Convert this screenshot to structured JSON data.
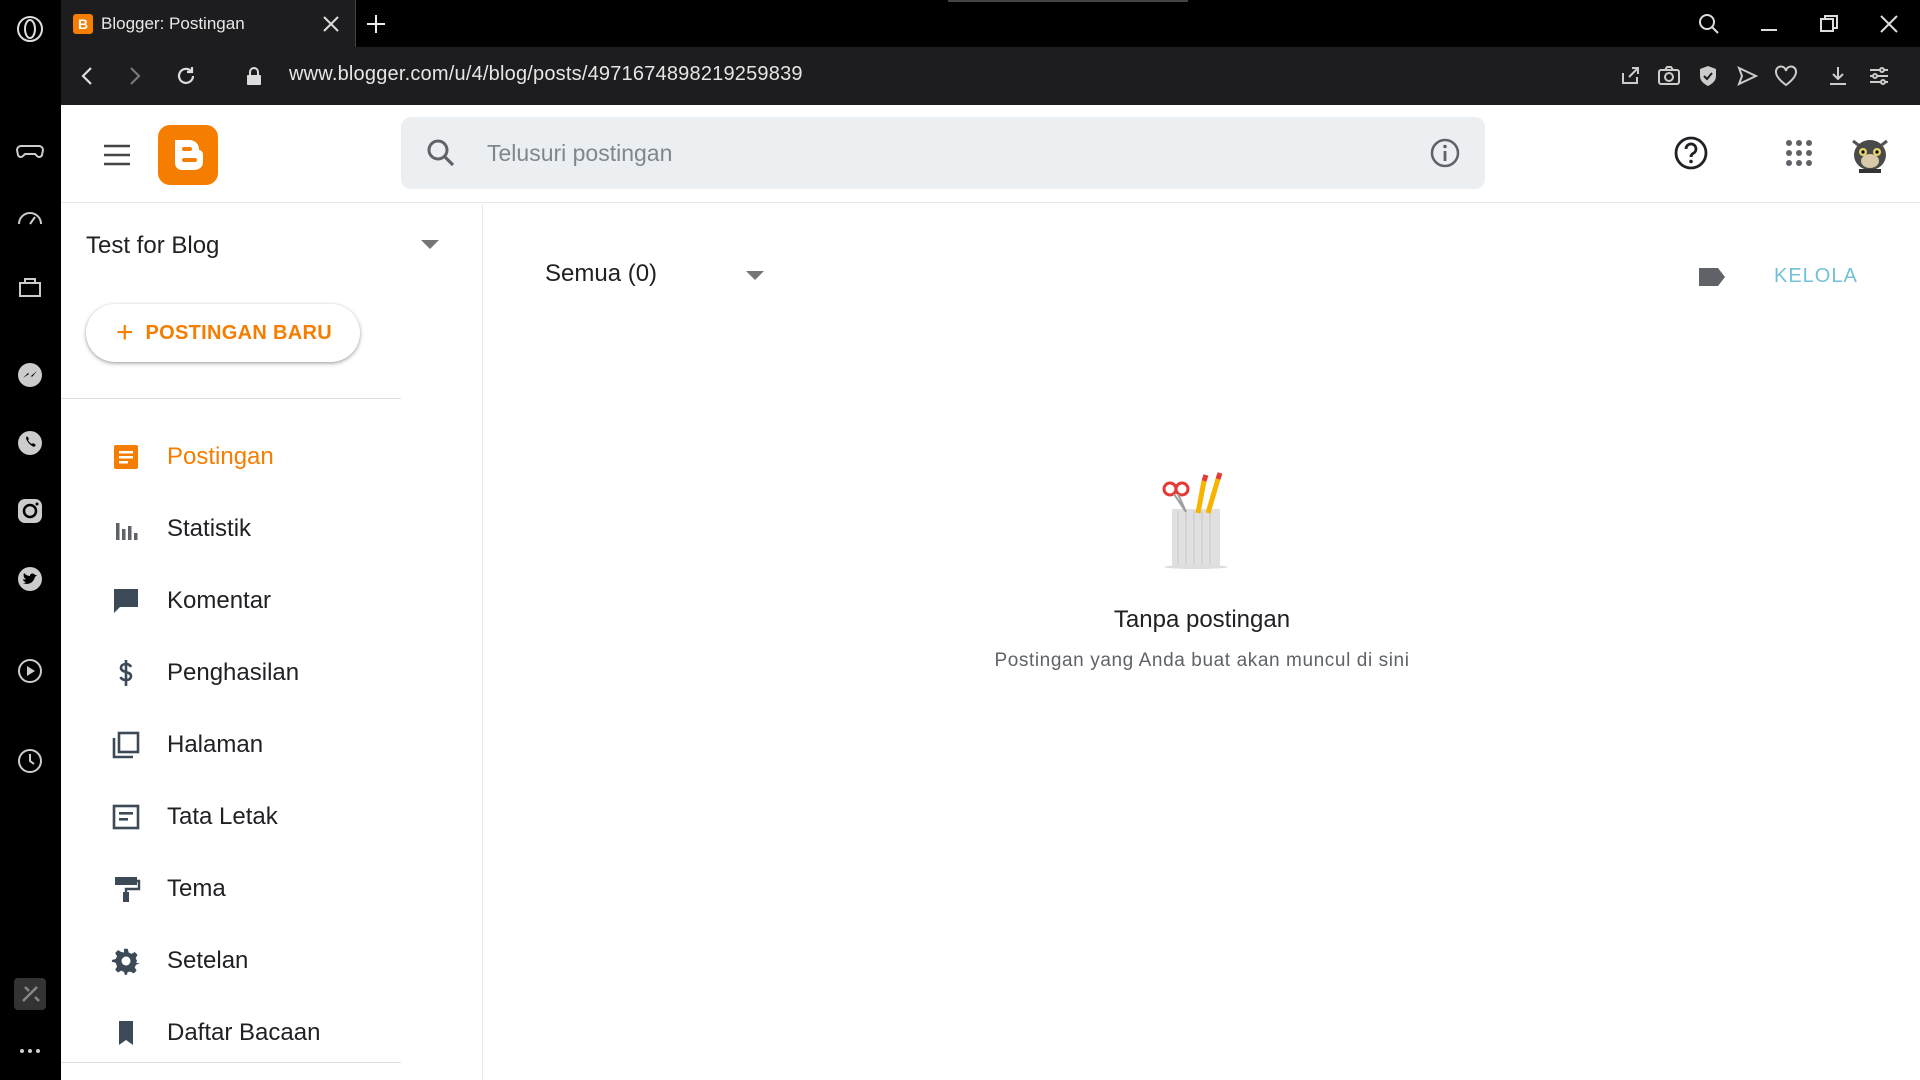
{
  "browser": {
    "tab_title": "Blogger: Postingan",
    "tab_favicon": "B",
    "url": "www.blogger.com/u/4/blog/posts/4971674898219259839"
  },
  "header": {
    "search_placeholder": "Telusuri postingan"
  },
  "sidebar": {
    "blog_name": "Test for Blog",
    "new_post_label": "POSTINGAN BARU",
    "items": [
      {
        "label": "Postingan",
        "icon": "posts-icon"
      },
      {
        "label": "Statistik",
        "icon": "stats-icon"
      },
      {
        "label": "Komentar",
        "icon": "comment-icon"
      },
      {
        "label": "Penghasilan",
        "icon": "dollar-icon"
      },
      {
        "label": "Halaman",
        "icon": "pages-icon"
      },
      {
        "label": "Tata Letak",
        "icon": "layout-icon"
      },
      {
        "label": "Tema",
        "icon": "paint-roller-icon"
      },
      {
        "label": "Setelan",
        "icon": "gear-icon"
      },
      {
        "label": "Daftar Bacaan",
        "icon": "bookmark-icon"
      }
    ]
  },
  "content": {
    "filter_label": "Semua (0)",
    "manage_label": "KELOLA",
    "empty_title": "Tanpa postingan",
    "empty_subtitle": "Postingan yang Anda buat akan muncul di sini"
  },
  "colors": {
    "accent": "#f57d00",
    "manage": "#72c1d8"
  }
}
